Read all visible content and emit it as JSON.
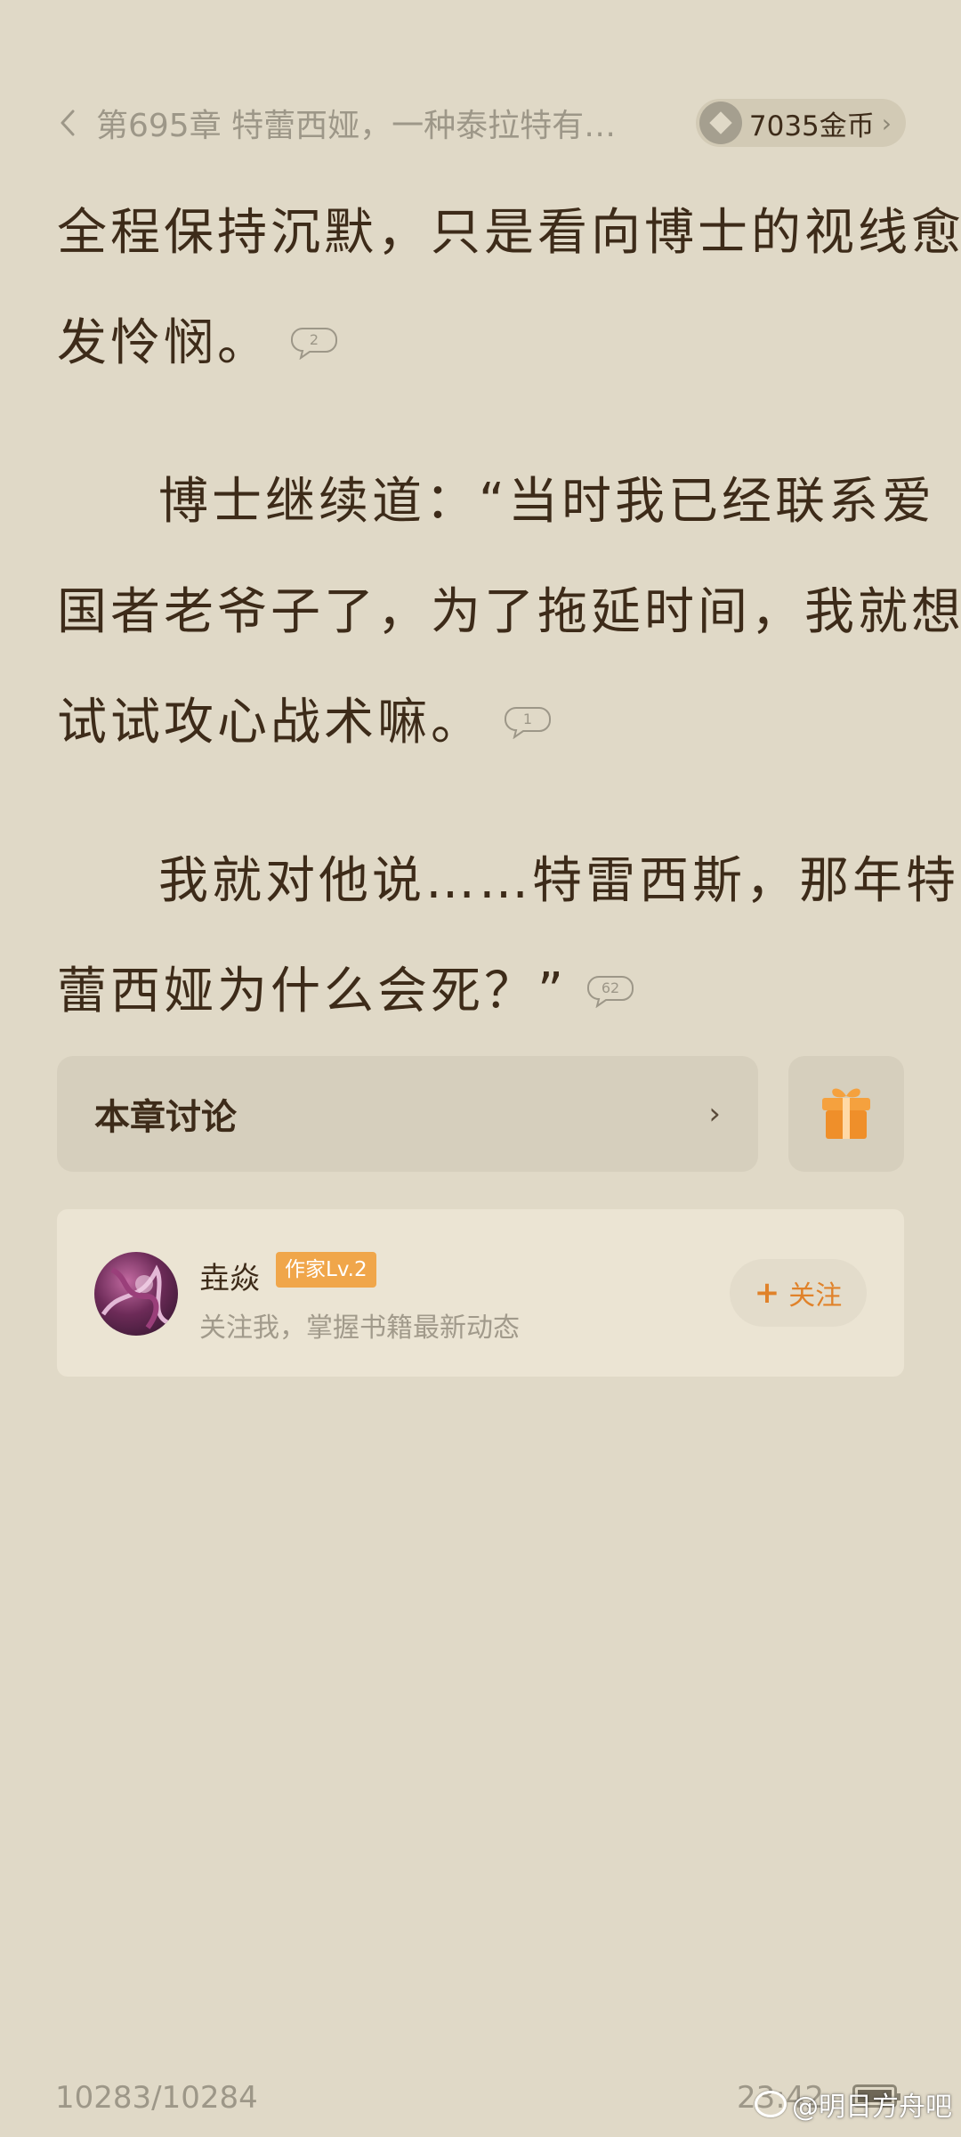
{
  "header": {
    "chapter_title": "第695章 特蕾西娅，一种泰拉特有…",
    "coins": "7035金币"
  },
  "content": {
    "lines": [
      "全程保持沉默，只是看向博士的视线愈",
      "发怜悯。",
      "博士继续道：“当时我已经联系爱",
      "国者老爷子了，为了拖延时间，我就想",
      "试试攻心战术嘛。",
      "我就对他说……特雷西斯，那年特",
      "蕾西娅为什么会死？”"
    ],
    "comments": {
      "para1": "2",
      "para2": "1",
      "para3": "62"
    }
  },
  "discussion": {
    "label": "本章讨论"
  },
  "author": {
    "name": "垚焱",
    "badge": "作家Lv.2",
    "subtitle": "关注我，掌握书籍最新动态",
    "follow_label": "关注"
  },
  "footer": {
    "page_progress": "10283/10284",
    "clock": "23:42",
    "watermark": "@明日方舟吧"
  },
  "colors": {
    "background": "#e0d9c7",
    "text": "#3d2b19",
    "accent": "#f0a64a",
    "follow": "#e0822a"
  }
}
